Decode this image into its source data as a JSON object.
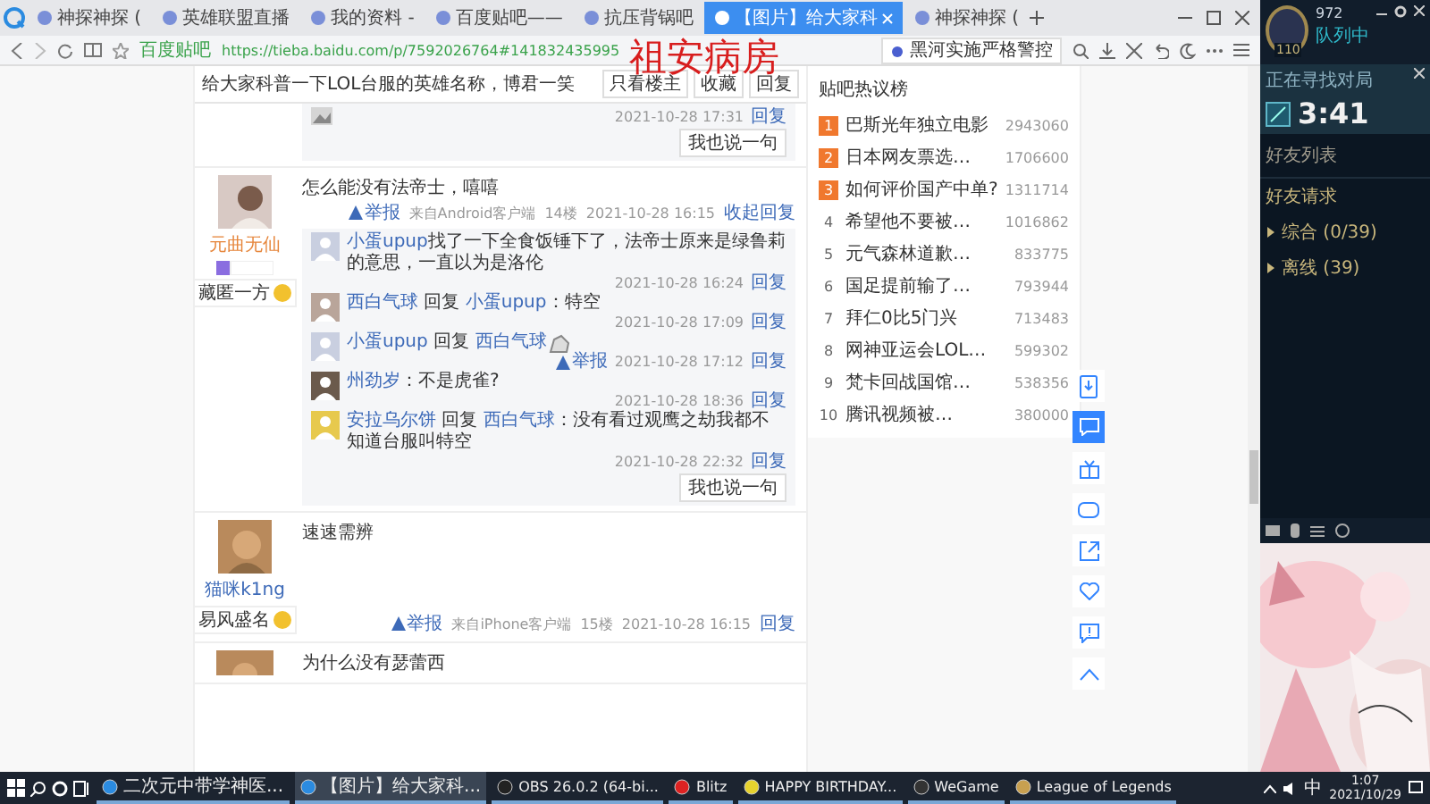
{
  "browser": {
    "tabs": [
      {
        "title": "神探神探 (",
        "selected": false
      },
      {
        "title": "英雄联盟直播",
        "selected": false
      },
      {
        "title": "我的资料 -",
        "selected": false
      },
      {
        "title": "百度贴吧——",
        "selected": false
      },
      {
        "title": "抗压背锅吧",
        "selected": false
      },
      {
        "title": "【图片】给大家科",
        "selected": true
      },
      {
        "title": "神探神探 (",
        "selected": false
      }
    ],
    "address_bar": {
      "site_label": "百度贴吧",
      "url": "https://tieba.baidu.com/p/7592026764#141832435995"
    },
    "search_field": {
      "value": "黑河实施严格警控"
    }
  },
  "overlay_text": "祖安病房",
  "thread": {
    "title": "给大家科普一下LOL台服的英雄名称，博君一笑",
    "actions": [
      "只看楼主",
      "收藏",
      "回复"
    ],
    "posts": [
      {
        "kind": "tail",
        "time": "2021-10-28 17:31",
        "reply_link": "回复",
        "comment_button": "我也说一句"
      },
      {
        "kind": "full",
        "username": "元曲无仙",
        "tag": "藏匿一方",
        "content": "怎么能没有法帝士，嘻嘻",
        "footer": {
          "report": "举报",
          "source": "来自Android客户端",
          "floor": "14楼",
          "time": "2021-10-28 16:15",
          "reply_link": "收起回复"
        },
        "replies": [
          {
            "kind": "text",
            "user": "小蛋upup",
            "content": "找了一下全食饭锤下了，法帝士原来是绿鲁莉的意思，一直以为是洛伦",
            "time": "2021-10-28 16:24",
            "reply_link": "回复"
          },
          {
            "kind": "text",
            "user": "西白气球",
            "reply_word": "回复",
            "target": "小蛋upup",
            "content": "：特空",
            "time": "2021-10-28 17:09",
            "reply_link": "回复"
          },
          {
            "kind": "sticker",
            "user": "小蛋upup",
            "reply_word": "回复",
            "target": "西白气球",
            "report": "举报",
            "time": "2021-10-28 17:12",
            "reply_link": "回复"
          },
          {
            "kind": "text",
            "user": "州劲岁",
            "content": "：不是虎雀?",
            "time": "2021-10-28 18:36",
            "reply_link": "回复"
          },
          {
            "kind": "text",
            "user": "安拉乌尔饼",
            "reply_word": "回复",
            "target": "西白气球",
            "content": "：没有看过观鹰之劫我都不知道台服叫特空",
            "time": "2021-10-28 22:32",
            "reply_link": "回复"
          }
        ],
        "comment_button": "我也说一句"
      },
      {
        "kind": "full",
        "username": "猫咪k1ng",
        "tag": "易风盛名",
        "content": "速速需辨",
        "footer": {
          "report": "举报",
          "source": "来自iPhone客户端",
          "floor": "15楼",
          "time": "2021-10-28 16:15",
          "reply_link": "回复"
        }
      },
      {
        "kind": "partial",
        "content": "为什么没有瑟蕾西"
      }
    ]
  },
  "hot_list": {
    "title": "贴吧热议榜",
    "items": [
      {
        "rank": "1",
        "title": "巴斯光年独立电影",
        "count": "2943060",
        "highlighted": true
      },
      {
        "rank": "2",
        "title": "日本网友票选…",
        "count": "1706600",
        "highlighted": true
      },
      {
        "rank": "3",
        "title": "如何评价国产中单?",
        "count": "1311714",
        "highlighted": true
      },
      {
        "rank": "4",
        "title": "希望他不要被…",
        "count": "1016862",
        "highlighted": false
      },
      {
        "rank": "5",
        "title": "元气森林道歉…",
        "count": "833775",
        "highlighted": false
      },
      {
        "rank": "6",
        "title": "国足提前输了…",
        "count": "793944",
        "highlighted": false
      },
      {
        "rank": "7",
        "title": "拜仁0比5门兴",
        "count": "713483",
        "highlighted": false
      },
      {
        "rank": "8",
        "title": "网神亚运会LOL…",
        "count": "599302",
        "highlighted": false
      },
      {
        "rank": "9",
        "title": "梵卡回战国馆…",
        "count": "538356",
        "highlighted": false
      },
      {
        "rank": "10",
        "title": "腾讯视频被…",
        "count": "380000",
        "highlighted": false
      }
    ]
  },
  "client": {
    "level": "110",
    "currency": "972",
    "status": "队列中",
    "queue": {
      "label": "正在寻找对局",
      "timer": "3:41"
    },
    "friends_header": "好友列表",
    "friend_requests": "好友请求",
    "groups": [
      {
        "label": "综合 (0/39)",
        "expanded": false
      },
      {
        "label": "离线 (39)",
        "expanded": false
      }
    ]
  },
  "taskbar": {
    "items": [
      {
        "label": "二次元中带学神医...",
        "active": false
      },
      {
        "label": "【图片】给大家科...",
        "active": true
      },
      {
        "label": "OBS 26.0.2 (64-bi...",
        "active": false
      },
      {
        "label": "Blitz",
        "active": false
      },
      {
        "label": "HAPPY BIRTHDAY...",
        "active": false
      },
      {
        "label": "WeGame",
        "active": false
      },
      {
        "label": "League of Legends",
        "active": false
      }
    ],
    "ime": "中",
    "time": "1:07",
    "date": "2021/10/29"
  }
}
